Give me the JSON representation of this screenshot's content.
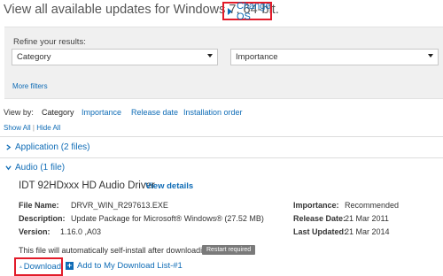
{
  "header": {
    "title": "View all available updates for Windows 7, 64-bit.",
    "change_os": "Change OS"
  },
  "filters": {
    "refine_label": "Refine your results:",
    "category_value": "Category",
    "importance_value": "Importance",
    "more_filters": "More filters"
  },
  "view_by": {
    "label": "View by:",
    "options": [
      "Category",
      "Importance",
      "Release date",
      "Installation order"
    ],
    "selected": "Category",
    "show_all": "Show All",
    "separator": "|",
    "hide_all": "Hide All"
  },
  "sections": {
    "application": {
      "label": "Application (2 files)",
      "expanded": false
    },
    "audio": {
      "label": "Audio (1 file)",
      "expanded": true
    }
  },
  "driver": {
    "title": "IDT 92HDxxx HD Audio Driver",
    "view_details": "View details",
    "file_name_label": "File Name:",
    "file_name": "DRVR_WIN_R297613.EXE",
    "description_label": "Description:",
    "description": "Update Package for Microsoft® Windows® (27.52 MB)",
    "version_label": "Version:",
    "version": "1.16.0 ,A03",
    "importance_label": "Importance:",
    "importance": "Recommended",
    "release_date_label": "Release Date:",
    "release_date": "21 Mar 2011",
    "last_updated_label": "Last Updated:",
    "last_updated": "21 Mar 2014",
    "auto_install_note": "This file will automatically self-install after downloading.",
    "restart_badge": "Restart required",
    "download": "Download",
    "add_to_list": "Add to My Download List-#1"
  },
  "colors": {
    "link": "#0f6cb6",
    "highlight_box": "#e21c2a",
    "panel_bg": "#f0f0f0",
    "badge_bg": "#7a7a7a"
  }
}
